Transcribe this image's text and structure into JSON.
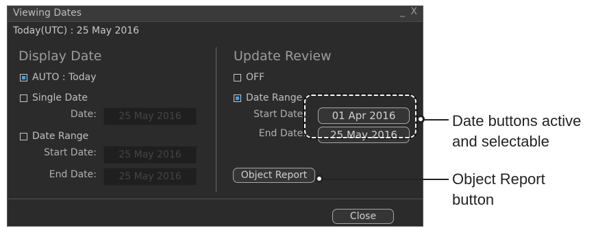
{
  "window": {
    "title": "Viewing Dates",
    "controls": "_ X"
  },
  "today": {
    "label": "Today(UTC) :",
    "value": "25 May 2016"
  },
  "display_date": {
    "title": "Display Date",
    "auto_label": "AUTO : Today",
    "single_label": "Single Date",
    "single_date_label": "Date:",
    "single_date_value": "25 May 2016",
    "range_label": "Date Range",
    "start_label": "Start Date:",
    "start_value": "25 May 2016",
    "end_label": "End  Date:",
    "end_value": "25 May 2016"
  },
  "update_review": {
    "title": "Update Review",
    "off_label": "OFF",
    "range_label": "Date Range",
    "start_label": "Start Date:",
    "start_value": "01 Apr 2016",
    "end_label": "End  Date:",
    "end_value": "25 May 2016",
    "object_report_label": "Object Report"
  },
  "footer": {
    "close_label": "Close"
  },
  "callouts": {
    "date_buttons": "Date buttons active\nand selectable",
    "object_report": "Object Report\nbutton"
  },
  "colors": {
    "dialog_bg": "#2b2b2b",
    "checked_indicator": "#3fa3e8"
  }
}
